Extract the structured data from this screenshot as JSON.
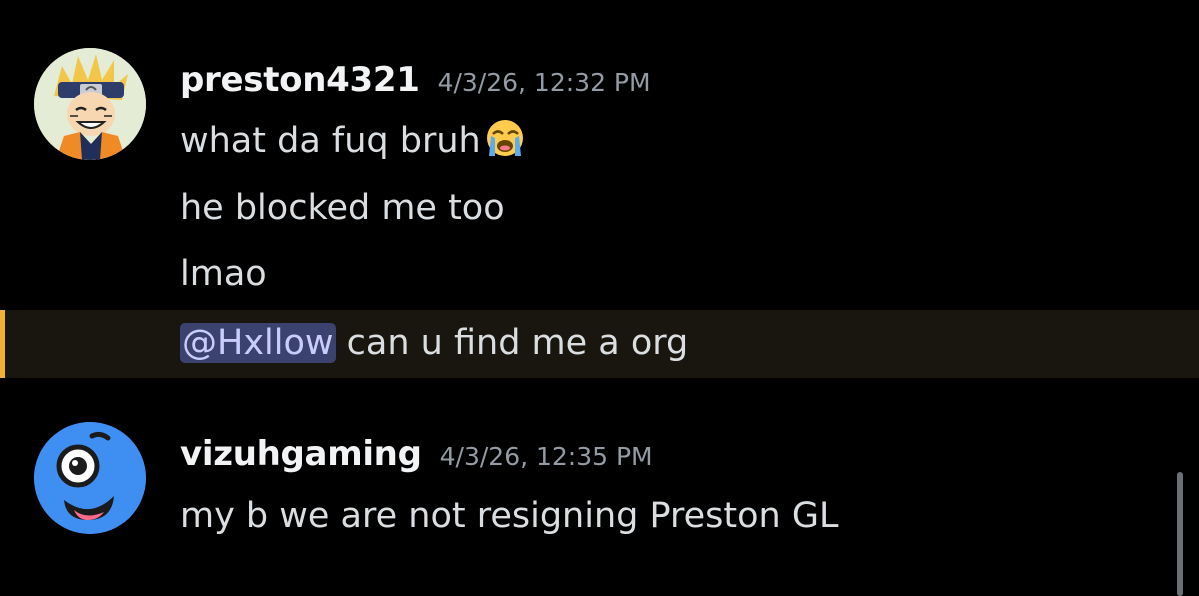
{
  "messages": [
    {
      "username": "preston4321",
      "timestamp": "4/3/26, 12:32 PM",
      "avatar": "naruto-avatar",
      "lines": [
        "what da fuq bruh",
        "he blocked me too",
        "lmao"
      ],
      "emoji": "loudly-crying-face-emoji",
      "mention_line": {
        "mention": "@Hxllow",
        "text": " can u find me a org"
      }
    },
    {
      "username": "vizuhgaming",
      "timestamp": "4/3/26, 12:35 PM",
      "avatar": "blue-cartoon-face-avatar",
      "lines": [
        "my b we are not resigning Preston GL"
      ]
    }
  ],
  "colors": {
    "background": "#000000",
    "username": "#f2f3f5",
    "timestamp": "#949ba4",
    "message_text": "#dbdee1",
    "mention_highlight_bg": "#18160e",
    "mention_highlight_bar": "#f0b232",
    "mention_pill_bg": "#3c4270",
    "mention_pill_text": "#c9cdfb"
  }
}
